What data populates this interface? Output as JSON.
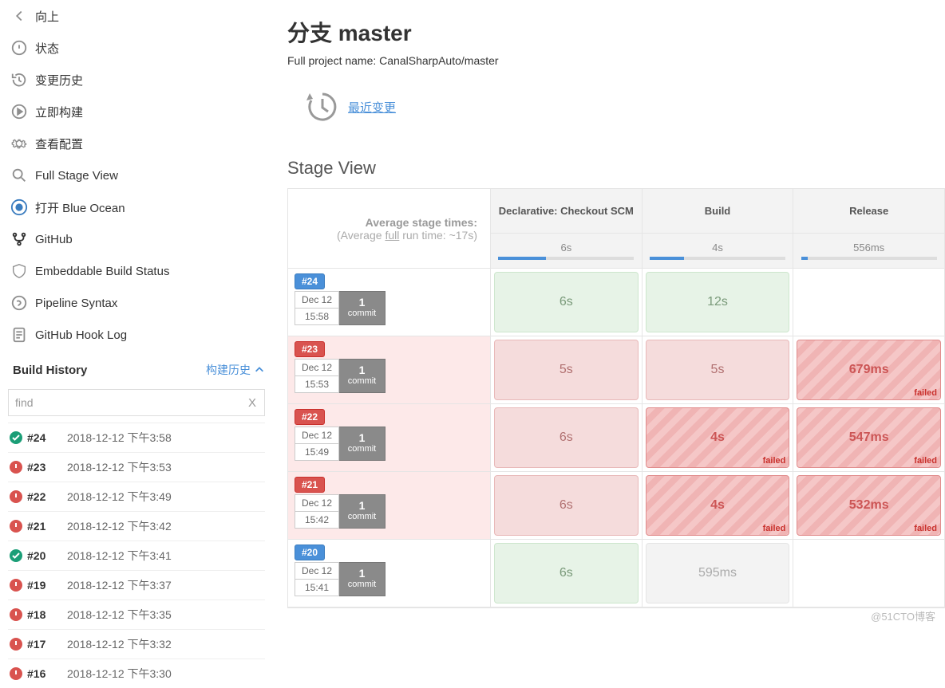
{
  "sidebar": {
    "items": [
      {
        "id": "up",
        "label": "向上"
      },
      {
        "id": "status",
        "label": "状态"
      },
      {
        "id": "changes",
        "label": "变更历史"
      },
      {
        "id": "build-now",
        "label": "立即构建"
      },
      {
        "id": "configure",
        "label": "查看配置"
      },
      {
        "id": "full-stage-view",
        "label": "Full Stage View"
      },
      {
        "id": "open-blue-ocean",
        "label": "打开 Blue Ocean"
      },
      {
        "id": "github",
        "label": "GitHub"
      },
      {
        "id": "embed-status",
        "label": "Embeddable Build Status"
      },
      {
        "id": "pipeline-syntax",
        "label": "Pipeline Syntax"
      },
      {
        "id": "github-hook-log",
        "label": "GitHub Hook Log"
      }
    ],
    "buildHistory": {
      "title": "Build History",
      "trendLabel": "构建历史"
    },
    "filter": {
      "value": "find",
      "clear": "X"
    }
  },
  "history": [
    {
      "num": "#24",
      "time": "2018-12-12 下午3:58",
      "status": "success"
    },
    {
      "num": "#23",
      "time": "2018-12-12 下午3:53",
      "status": "failure"
    },
    {
      "num": "#22",
      "time": "2018-12-12 下午3:49",
      "status": "failure"
    },
    {
      "num": "#21",
      "time": "2018-12-12 下午3:42",
      "status": "failure"
    },
    {
      "num": "#20",
      "time": "2018-12-12 下午3:41",
      "status": "success"
    },
    {
      "num": "#19",
      "time": "2018-12-12 下午3:37",
      "status": "failure"
    },
    {
      "num": "#18",
      "time": "2018-12-12 下午3:35",
      "status": "failure"
    },
    {
      "num": "#17",
      "time": "2018-12-12 下午3:32",
      "status": "failure"
    },
    {
      "num": "#16",
      "time": "2018-12-12 下午3:30",
      "status": "failure"
    }
  ],
  "page": {
    "title": "分支 master",
    "subtitle": "Full project name: CanalSharpAuto/master",
    "recentChangesLabel": "最近变更",
    "stageViewTitle": "Stage View",
    "avgLine1": "Average stage times:",
    "avgLine2a": "(Average ",
    "avgLine2b": "full",
    "avgLine2c": " run time: ~17s)"
  },
  "stages": {
    "headers": [
      "Declarative: Checkout SCM",
      "Build",
      "Release"
    ],
    "averages": [
      {
        "val": "6s",
        "pct": 35
      },
      {
        "val": "4s",
        "pct": 25
      },
      {
        "val": "556ms",
        "pct": 5
      }
    ],
    "runs": [
      {
        "badge": "#24",
        "status": "success",
        "date": "Dec 12",
        "time": "15:58",
        "commits": "1",
        "commitLabel": "commit",
        "cells": [
          {
            "text": "6s",
            "style": "ok-lt"
          },
          {
            "text": "12s",
            "style": "ok-lt"
          },
          {
            "text": "",
            "style": "empty"
          }
        ]
      },
      {
        "badge": "#23",
        "status": "failure",
        "date": "Dec 12",
        "time": "15:53",
        "commits": "1",
        "commitLabel": "commit",
        "cells": [
          {
            "text": "5s",
            "style": "fail-lt"
          },
          {
            "text": "5s",
            "style": "fail-lt"
          },
          {
            "text": "679ms",
            "style": "fail-hatch",
            "failed": "failed"
          }
        ]
      },
      {
        "badge": "#22",
        "status": "failure",
        "date": "Dec 12",
        "time": "15:49",
        "commits": "1",
        "commitLabel": "commit",
        "cells": [
          {
            "text": "6s",
            "style": "fail-lt"
          },
          {
            "text": "4s",
            "style": "fail-hatch",
            "failed": "failed"
          },
          {
            "text": "547ms",
            "style": "fail-hatch",
            "failed": "failed"
          }
        ]
      },
      {
        "badge": "#21",
        "status": "failure",
        "date": "Dec 12",
        "time": "15:42",
        "commits": "1",
        "commitLabel": "commit",
        "cells": [
          {
            "text": "6s",
            "style": "fail-lt"
          },
          {
            "text": "4s",
            "style": "fail-hatch",
            "failed": "failed"
          },
          {
            "text": "532ms",
            "style": "fail-hatch",
            "failed": "failed"
          }
        ]
      },
      {
        "badge": "#20",
        "status": "success",
        "date": "Dec 12",
        "time": "15:41",
        "commits": "1",
        "commitLabel": "commit",
        "cells": [
          {
            "text": "6s",
            "style": "ok-lt"
          },
          {
            "text": "595ms",
            "style": "ok-dim"
          },
          {
            "text": "",
            "style": "empty"
          }
        ]
      }
    ]
  },
  "watermark": "@51CTO博客"
}
